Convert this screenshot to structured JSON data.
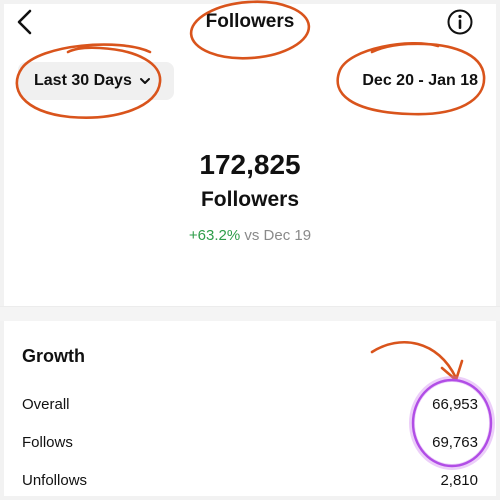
{
  "header": {
    "title": "Followers",
    "back_icon": "chevron-left-icon",
    "info_icon": "info-icon"
  },
  "controls": {
    "range_label": "Last 30 Days",
    "range_icon": "chevron-down-icon",
    "date_range": "Dec 20 - Jan 18"
  },
  "summary": {
    "count": "172,825",
    "label": "Followers",
    "change_pct": "+63.2%",
    "change_vs": "vs Dec 19"
  },
  "growth": {
    "title": "Growth",
    "rows": [
      {
        "label": "Overall",
        "value": "66,953"
      },
      {
        "label": "Follows",
        "value": "69,763"
      },
      {
        "label": "Unfollows",
        "value": "2,810"
      }
    ]
  },
  "colors": {
    "annotation": "#d9541c",
    "highlight": "#c974ef",
    "positive": "#2e9d4a",
    "muted": "#8a8a8a"
  }
}
